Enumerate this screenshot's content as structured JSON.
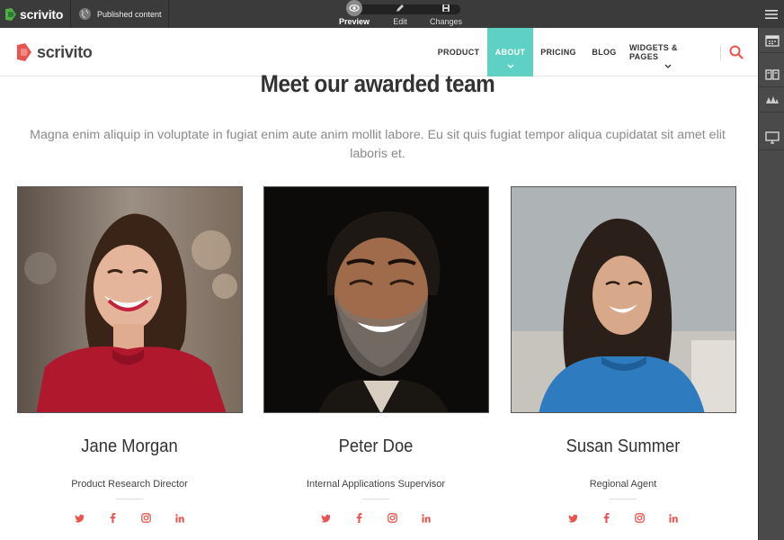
{
  "editor": {
    "logo_text": "scrivito",
    "published_label": "Published content",
    "modes": [
      {
        "label": "Preview",
        "icon": "eye-icon",
        "active": true
      },
      {
        "label": "Edit",
        "icon": "pencil-icon",
        "active": false
      },
      {
        "label": "Changes",
        "icon": "save-icon",
        "active": false
      }
    ],
    "sidebar_icons": [
      "calendar-icon",
      "library-icon",
      "widgets-icon",
      "monitor-icon"
    ]
  },
  "site": {
    "logo_text": "scrivito",
    "nav": [
      {
        "label": "PRODUCT",
        "active": false,
        "has_dropdown": false
      },
      {
        "label": "ABOUT",
        "active": true,
        "has_dropdown": true
      },
      {
        "label": "PRICING",
        "active": false,
        "has_dropdown": false
      },
      {
        "label": "BLOG",
        "active": false,
        "has_dropdown": false
      },
      {
        "label": "WIDGETS & PAGES",
        "active": false,
        "has_dropdown": true
      }
    ],
    "accent_color": "#5ed1c4",
    "brand_color": "#e8554e"
  },
  "team": {
    "title": "Meet our awarded team",
    "intro": "Magna enim aliquip in voluptate in fugiat enim aute anim mollit labore. Eu sit quis fugiat tempor aliqua cupidatat sit amet elit laboris et.",
    "members": [
      {
        "name": "Jane Morgan",
        "role": "Product Research Director"
      },
      {
        "name": "Peter Doe",
        "role": "Internal Applications Supervisor"
      },
      {
        "name": "Susan Summer",
        "role": "Regional Agent"
      }
    ],
    "social_icons": [
      "twitter-icon",
      "facebook-icon",
      "instagram-icon",
      "linkedin-icon"
    ]
  }
}
